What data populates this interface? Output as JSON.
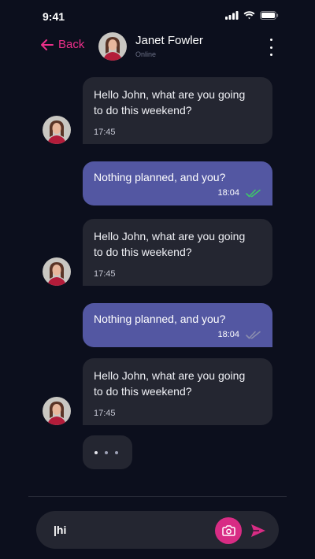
{
  "statusbar": {
    "time": "9:41"
  },
  "header": {
    "back_label": "Back",
    "contact_name": "Janet Fowler",
    "contact_status": "Online"
  },
  "messages": [
    {
      "direction": "incoming",
      "line1": "Hello John, what are you going",
      "line2": "to do this weekend?",
      "time": "17:45"
    },
    {
      "direction": "outgoing",
      "text": "Nothing planned, and you?",
      "time": "18:04",
      "status": "read"
    },
    {
      "direction": "incoming",
      "line1": "Hello John, what are you going",
      "line2": "to do this weekend?",
      "time": "17:45"
    },
    {
      "direction": "outgoing",
      "text": "Nothing planned, and you?",
      "time": "18:04",
      "status": "delivered"
    },
    {
      "direction": "incoming",
      "line1": "Hello John, what are you going",
      "line2": "to do this weekend?",
      "time": "17:45"
    }
  ],
  "composer": {
    "value": "|hi"
  },
  "colors": {
    "accent": "#ec2f8a",
    "outgoing_bubble": "#5357a2",
    "incoming_bubble": "#242631",
    "read_check": "#3fc46a",
    "background": "#0c0f1d"
  },
  "icons": [
    "back-arrow-icon",
    "more-vertical-icon",
    "camera-icon",
    "send-icon",
    "signal-icon",
    "wifi-icon",
    "battery-icon",
    "double-check-icon"
  ]
}
